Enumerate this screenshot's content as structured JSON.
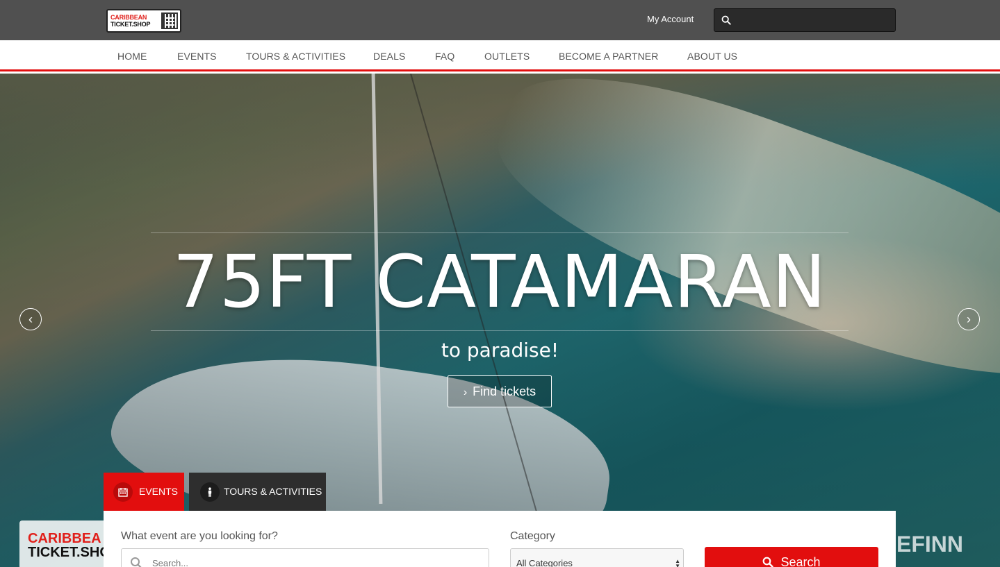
{
  "header": {
    "logo": {
      "line1": "CARIBBEAN",
      "line2": "TICKET.SHOP"
    },
    "my_account": "My Account",
    "search": {
      "icon": "search-icon",
      "placeholder": ""
    }
  },
  "nav": {
    "items": [
      {
        "label": "HOME"
      },
      {
        "label": "EVENTS"
      },
      {
        "label": "TOURS & ACTIVITIES"
      },
      {
        "label": "DEALS"
      },
      {
        "label": "FAQ"
      },
      {
        "label": "OUTLETS"
      },
      {
        "label": "BECOME A PARTNER"
      },
      {
        "label": "ABOUT US"
      }
    ],
    "accent_color": "#e20e0e"
  },
  "hero": {
    "title": "75FT CATAMARAN",
    "subtitle": "to paradise!",
    "cta_label": "Find tickets",
    "prev_icon": "chevron-left-icon",
    "next_icon": "chevron-right-icon",
    "watermark_left": {
      "line1": "CARIBBEA",
      "line2": "TICKET.SHO"
    },
    "watermark_right": "EFINN"
  },
  "search_panel": {
    "tabs": [
      {
        "label": "EVENTS",
        "icon": "calendar-icon",
        "active": true
      },
      {
        "label": "TOURS & ACTIVITIES",
        "icon": "person-icon",
        "active": false
      }
    ],
    "query_label": "What event are you looking for?",
    "query_placeholder": "Search...",
    "category_label": "Category",
    "category_value": "All Categories",
    "search_button": "Search"
  },
  "colors": {
    "primary_red": "#e20e0e",
    "topbar": "#505050",
    "dark_tab": "#2e2e2e"
  }
}
